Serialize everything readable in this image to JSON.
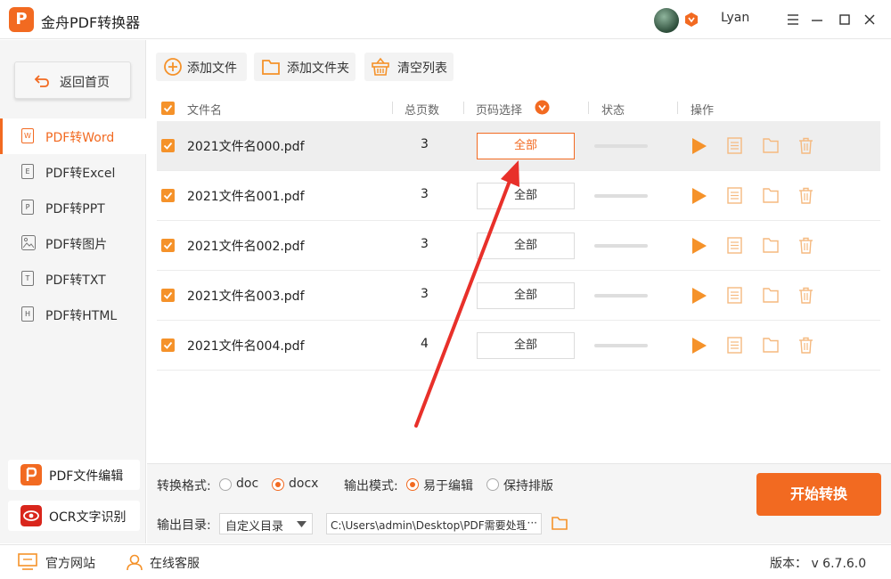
{
  "app": {
    "title": "金舟PDF转换器",
    "logo_letter": "P",
    "username": "Lyan"
  },
  "colors": {
    "accent": "#f26a21",
    "checkbox": "#f5922a",
    "annotation_arrow": "#e8302a"
  },
  "sidebar": {
    "home_label": "返回首页",
    "items": [
      {
        "label": "PDF转Word",
        "icon": "W",
        "active": true
      },
      {
        "label": "PDF转Excel",
        "icon": "E",
        "active": false
      },
      {
        "label": "PDF转PPT",
        "icon": "P",
        "active": false
      },
      {
        "label": "PDF转图片",
        "icon": "img",
        "active": false
      },
      {
        "label": "PDF转TXT",
        "icon": "T",
        "active": false
      },
      {
        "label": "PDF转HTML",
        "icon": "H",
        "active": false
      }
    ],
    "pdf_edit_label": "PDF文件编辑",
    "ocr_label": "OCR文字识别"
  },
  "toolbar": {
    "add_file": "添加文件",
    "add_folder": "添加文件夹",
    "clear_list": "清空列表"
  },
  "table": {
    "headers": {
      "filename": "文件名",
      "total_pages": "总页数",
      "page_select": "页码选择",
      "status": "状态",
      "actions": "操作"
    },
    "rows": [
      {
        "filename": "2021文件名000.pdf",
        "pages": "3",
        "page_select": "全部",
        "selected": true
      },
      {
        "filename": "2021文件名001.pdf",
        "pages": "3",
        "page_select": "全部",
        "selected": false
      },
      {
        "filename": "2021文件名002.pdf",
        "pages": "3",
        "page_select": "全部",
        "selected": false
      },
      {
        "filename": "2021文件名003.pdf",
        "pages": "3",
        "page_select": "全部",
        "selected": false
      },
      {
        "filename": "2021文件名004.pdf",
        "pages": "4",
        "page_select": "全部",
        "selected": false
      }
    ]
  },
  "bottom": {
    "format_label": "转换格式:",
    "format_doc": "doc",
    "format_docx": "docx",
    "format_selected": "docx",
    "mode_label": "输出模式:",
    "mode_easy": "易于编辑",
    "mode_keep": "保持排版",
    "mode_selected": "易于编辑",
    "dir_label": "输出目录:",
    "dir_select": "自定义目录",
    "dir_path": "C:\\Users\\admin\\Desktop\\PDF需要处理",
    "dir_path_more": "···",
    "start_button": "开始转换"
  },
  "statusbar": {
    "website": "官方网站",
    "support": "在线客服",
    "version": "版本： v 6.7.6.0"
  }
}
